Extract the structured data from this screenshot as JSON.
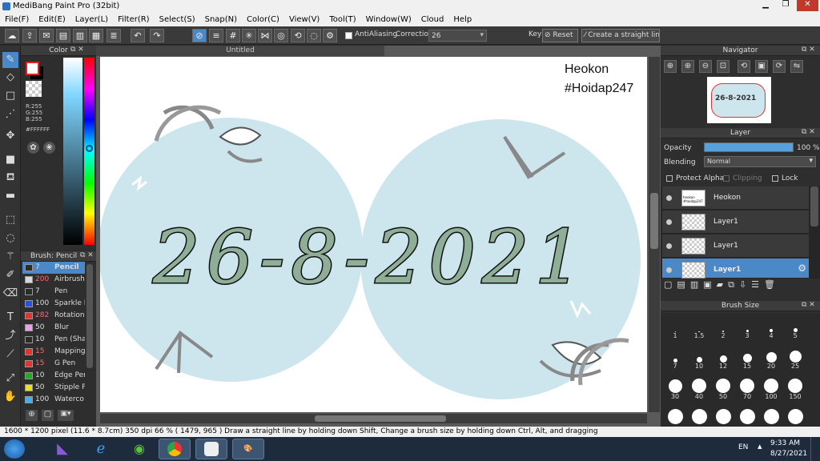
{
  "window": {
    "title": "MediBang Paint Pro (32bit)"
  },
  "menu": [
    "File(F)",
    "Edit(E)",
    "Layer(L)",
    "Filter(R)",
    "Select(S)",
    "Snap(N)",
    "Color(C)",
    "View(V)",
    "Tool(T)",
    "Window(W)",
    "Cloud",
    "Help"
  ],
  "toolbar": {
    "antialias_label": "AntiAliasing",
    "correction_label": "Correction",
    "correction_value": "26",
    "key_label": "Key",
    "reset_label": "Reset",
    "straight_label": "Create a straight line"
  },
  "color_panel": {
    "title": "Color",
    "r": "R:255",
    "g": "G:255",
    "b": "B:255",
    "hex": "#FFFFFF",
    "fg": "#ffffff",
    "bg": "#000000"
  },
  "brush_panel": {
    "title": "Brush: Pencil",
    "items": [
      {
        "size": "7",
        "name": "Pencil",
        "color": "#2b2b2b"
      },
      {
        "size": "200",
        "name": "Airbrush",
        "color": "#d8d8d8"
      },
      {
        "size": "7",
        "name": "Pen",
        "color": "#2b2b2b"
      },
      {
        "size": "100",
        "name": "Sparkle B",
        "color": "#2a4ee6"
      },
      {
        "size": "282",
        "name": "Rotation",
        "color": "#e83030"
      },
      {
        "size": "50",
        "name": "Blur",
        "color": "#e8a0e8"
      },
      {
        "size": "10",
        "name": "Pen (Sha",
        "color": "#2b2b2b"
      },
      {
        "size": "15",
        "name": "Mapping",
        "color": "#e83030"
      },
      {
        "size": "15",
        "name": "G Pen",
        "color": "#e83030"
      },
      {
        "size": "10",
        "name": "Edge Pen",
        "color": "#22aa22"
      },
      {
        "size": "50",
        "name": "Stipple P",
        "color": "#e8e020"
      },
      {
        "size": "100",
        "name": "Waterco",
        "color": "#40b0f0"
      }
    ]
  },
  "document": {
    "tab_title": "Untitled",
    "text_line1": "Heokon",
    "text_line2": "#Hoidap247",
    "artwork_date": "26-8-2021",
    "circle_color": "#cde6ee",
    "digit_color": "#8fae97"
  },
  "navigator": {
    "title": "Navigator",
    "thumb_text": "26-8-2021"
  },
  "layer_panel": {
    "title": "Layer",
    "opacity_label": "Opacity",
    "opacity_value": "100 %",
    "opacity_fraction": 1.0,
    "blending_label": "Blending",
    "blending_value": "Normal",
    "protect_alpha": "Protect Alpha",
    "clipping": "Clipping",
    "lock": "Lock",
    "layers": [
      {
        "name": "Heokon",
        "thumb": "heokon #hoidap247",
        "selected": false
      },
      {
        "name": "Layer1",
        "thumb": "",
        "selected": false
      },
      {
        "name": "Layer1",
        "thumb": "",
        "selected": false
      },
      {
        "name": "Layer1",
        "thumb": "",
        "selected": true
      }
    ]
  },
  "brush_size_panel": {
    "title": "Brush Size",
    "row1": [
      "1",
      "1.5",
      "2",
      "3",
      "4",
      "5"
    ],
    "row2": [
      "7",
      "10",
      "12",
      "15",
      "20",
      "25"
    ],
    "row3": [
      "30",
      "40",
      "50",
      "70",
      "100",
      "150"
    ]
  },
  "status_bar": {
    "text": "1600 * 1200 pixel  (11.6 * 8.7cm)  350 dpi  66 %  ( 1479, 965 )  Draw a straight line by holding down Shift, Change a brush size by holding down Ctrl, Alt, and dragging"
  },
  "taskbar": {
    "lang": "EN",
    "time": "9:33 AM",
    "date": "8/27/2021"
  }
}
